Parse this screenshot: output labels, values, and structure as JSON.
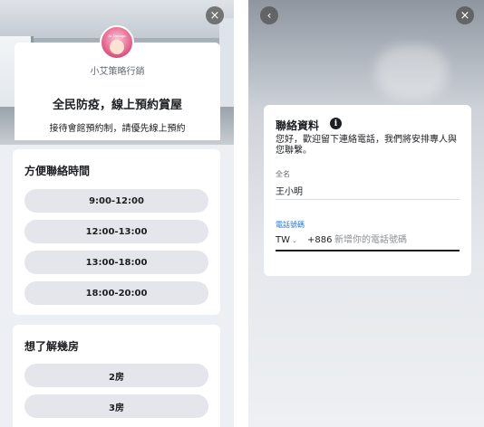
{
  "left": {
    "brand_name": "小艾策略行銷",
    "avatar_text": "Ai Design",
    "title": "全民防疫，線上預約賞屋",
    "subtitle": "接待會館預約制，請優先線上預約",
    "close_icon": "×",
    "questions": [
      {
        "title": "方便聯絡時間",
        "options": [
          "9:00-12:00",
          "12:00-13:00",
          "13:00-18:00",
          "18:00-20:00"
        ]
      },
      {
        "title": "想了解幾房",
        "options": [
          "2房",
          "3房"
        ]
      }
    ]
  },
  "right": {
    "back_icon": "‹",
    "close_icon": "×",
    "form_title": "聯絡資料",
    "info_icon": "i",
    "form_description": "您好，歡迎留下連絡電話，我們將安排專人與您聯繫。",
    "name_label": "全名",
    "name_value": "王小明",
    "phone_label": "電話號碼",
    "country_code": "TW",
    "country_chevron": "⌄",
    "dial_code": "+886",
    "phone_placeholder": "新增你的電話號碼"
  },
  "colors": {
    "accent": "#1877f2",
    "option_bg": "#e4e6eb",
    "page_bg": "#eceff3"
  }
}
